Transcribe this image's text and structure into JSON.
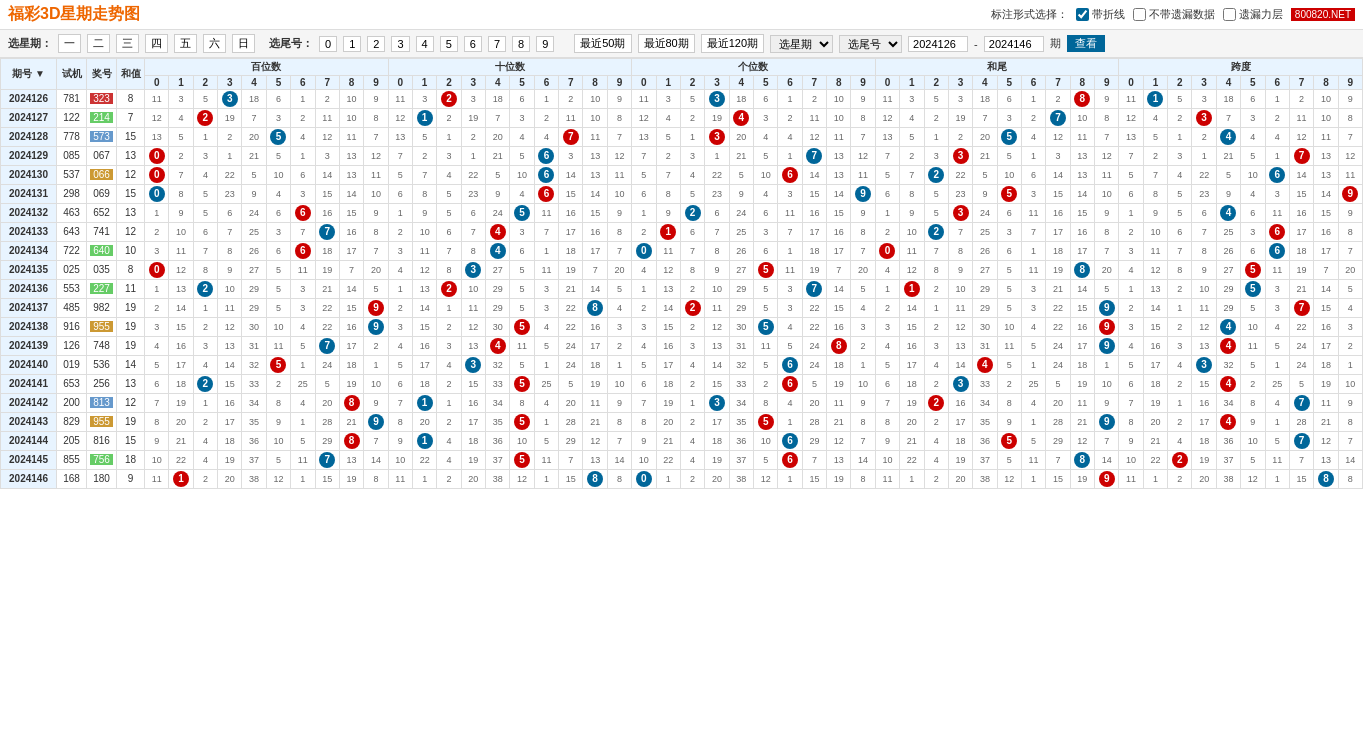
{
  "header": {
    "title": "福彩3D星期走势图",
    "site_badge": "800820.NET",
    "label_format": "标注形式选择：",
    "option_fold": "带折线",
    "option_no_miss": "不带遗漏数据",
    "option_miss_layer": "遗漏力层"
  },
  "filter": {
    "weekday_label": "选星期：",
    "weekdays": [
      "一",
      "二",
      "三",
      "四",
      "五",
      "六",
      "日"
    ],
    "tail_label": "选尾号：",
    "tails": [
      "0",
      "1",
      "2",
      "3",
      "4",
      "5",
      "6",
      "7",
      "8",
      "9"
    ],
    "recent_options": [
      "最近50期",
      "最近80期",
      "最近120期"
    ],
    "select_weekday": "选星期",
    "select_tail": "选尾号",
    "period_from": "2024126",
    "period_to": "2024146",
    "period_unit": "期",
    "query_btn": "查看"
  },
  "table": {
    "col_headers": [
      "期号",
      "试机",
      "奖号",
      "和值"
    ],
    "section_hundreds": "百位数",
    "section_tens": "十位数",
    "section_ones": "个位数",
    "section_sum_tail": "和尾",
    "section_span": "跨度",
    "digits": [
      "0",
      "1",
      "2",
      "3",
      "4",
      "5",
      "6",
      "7",
      "8",
      "9"
    ],
    "rows": [
      {
        "period": "2024126",
        "trial": "781",
        "award": "323",
        "award_style": "red",
        "sum": 8,
        "sep": false
      },
      {
        "period": "2024127",
        "trial": "122",
        "award": "214",
        "award_style": "green",
        "sum": 7,
        "sep": false
      },
      {
        "period": "2024128",
        "trial": "778",
        "award": "573",
        "award_style": "blue",
        "sum": 15,
        "sep": false
      },
      {
        "period": "2024129",
        "trial": "085",
        "award": "067",
        "award_style": "none",
        "sum": 13,
        "sep": false
      },
      {
        "period": "2024130",
        "trial": "537",
        "award": "066",
        "award_style": "yellow",
        "sum": 12,
        "sep": true
      },
      {
        "period": "2024131",
        "trial": "298",
        "award": "069",
        "award_style": "none",
        "sum": 15,
        "sep": false
      },
      {
        "period": "2024132",
        "trial": "463",
        "award": "652",
        "award_style": "none",
        "sum": 13,
        "sep": false
      },
      {
        "period": "2024133",
        "trial": "643",
        "award": "741",
        "award_style": "none",
        "sum": 12,
        "sep": false
      },
      {
        "period": "2024134",
        "trial": "722",
        "award": "640",
        "award_style": "green",
        "sum": 10,
        "sep": false
      },
      {
        "period": "2024135",
        "trial": "025",
        "award": "035",
        "award_style": "none",
        "sum": 8,
        "sep": true
      },
      {
        "period": "2024136",
        "trial": "553",
        "award": "227",
        "award_style": "green",
        "sum": 11,
        "sep": false
      },
      {
        "period": "2024137",
        "trial": "485",
        "award": "982",
        "award_style": "none",
        "sum": 19,
        "sep": false
      },
      {
        "period": "2024138",
        "trial": "916",
        "award": "955",
        "award_style": "yellow",
        "sum": 19,
        "sep": false
      },
      {
        "period": "2024139",
        "trial": "126",
        "award": "748",
        "award_style": "none",
        "sum": 19,
        "sep": false
      },
      {
        "period": "2024140",
        "trial": "019",
        "award": "536",
        "award_style": "none",
        "sum": 14,
        "sep": false
      },
      {
        "period": "2024141",
        "trial": "653",
        "award": "256",
        "award_style": "none",
        "sum": 13,
        "sep": false
      },
      {
        "period": "2024142",
        "trial": "200",
        "award": "813",
        "award_style": "blue",
        "sum": 12,
        "sep": false
      },
      {
        "period": "2024143",
        "trial": "829",
        "award": "955",
        "award_style": "yellow",
        "sum": 19,
        "sep": false
      },
      {
        "period": "2024144",
        "trial": "205",
        "award": "816",
        "award_style": "none",
        "sum": 15,
        "sep": false
      },
      {
        "period": "2024145",
        "trial": "855",
        "award": "756",
        "award_style": "green",
        "sum": 18,
        "sep": false
      },
      {
        "period": "2024146",
        "trial": "168",
        "award": "180",
        "award_style": "none",
        "sum": 9,
        "sep": false
      }
    ]
  },
  "colors": {
    "title": "#ee6600",
    "header_bg": "#d0e8ff",
    "cell_bg": "#e8f4ff",
    "circle_red": "#cc0000",
    "circle_blue": "#006699",
    "link": "#069"
  }
}
